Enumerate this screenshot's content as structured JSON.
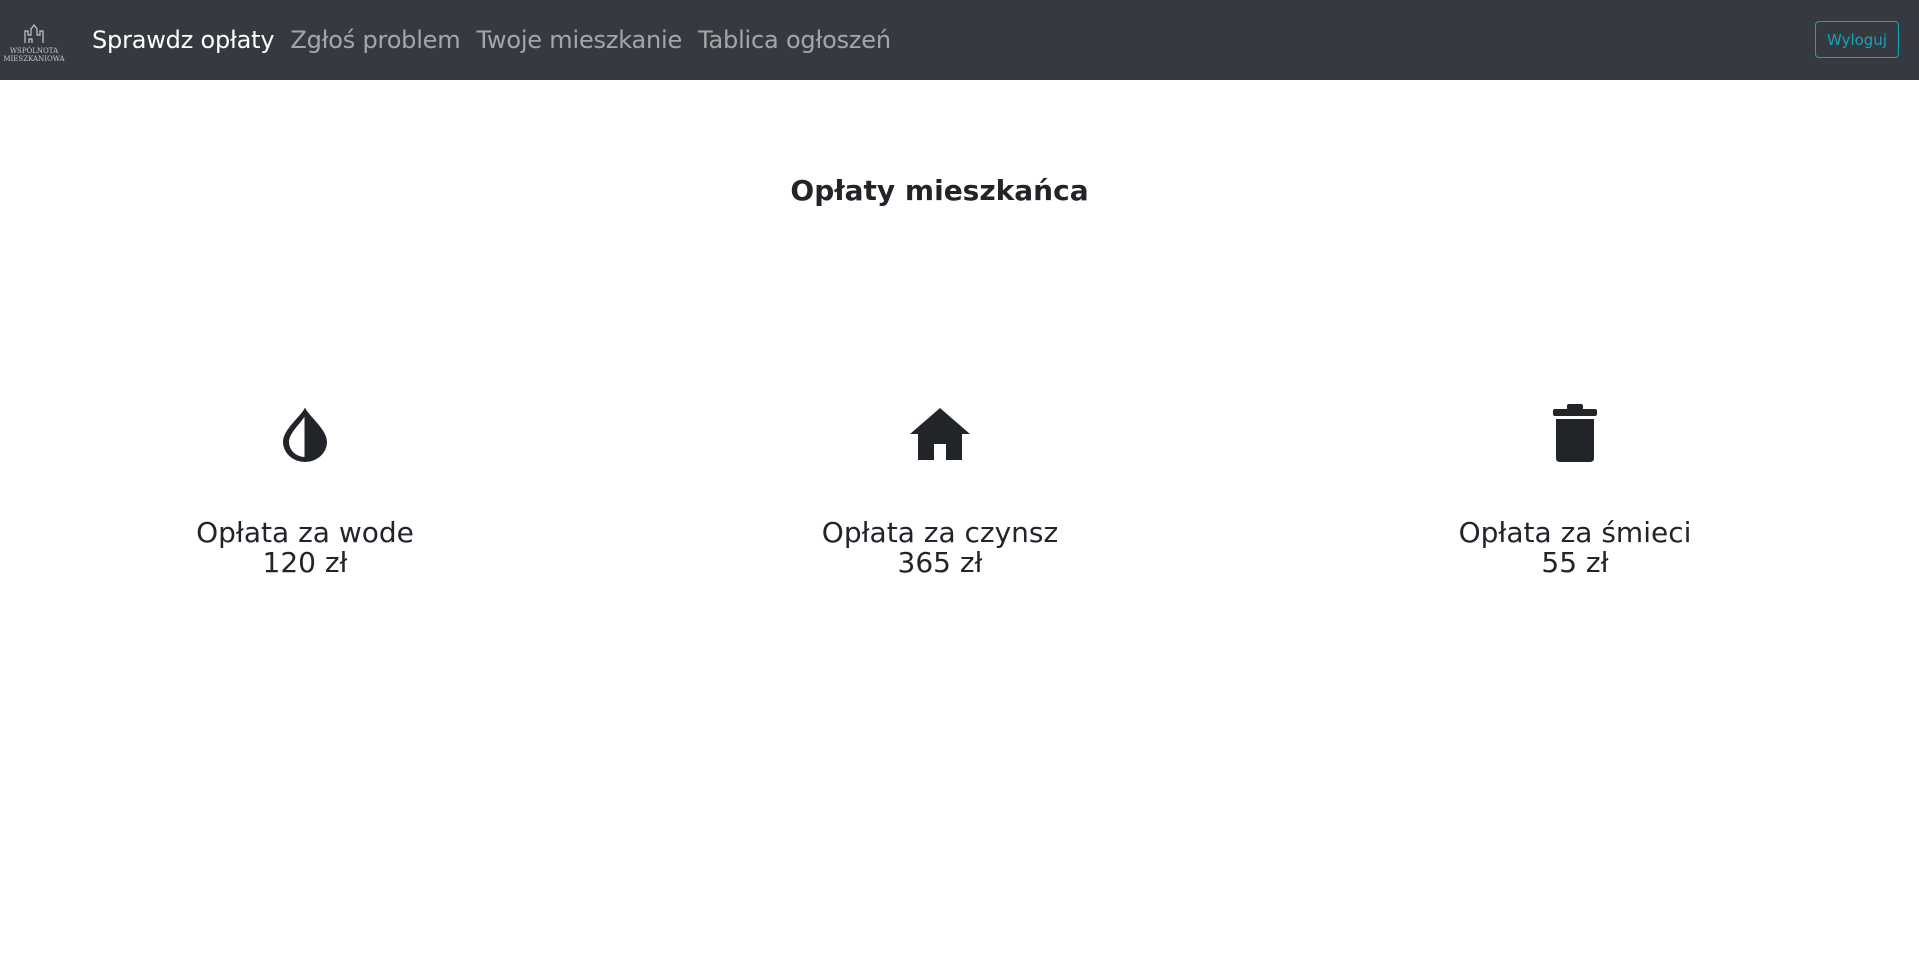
{
  "navbar": {
    "logo_text": [
      "WSPÓLNOTA",
      "MIESZKANIOWA"
    ],
    "links": [
      {
        "label": "Sprawdz opłaty",
        "active": true
      },
      {
        "label": "Zgłoś problem",
        "active": false
      },
      {
        "label": "Twoje mieszkanie",
        "active": false
      },
      {
        "label": "Tablica ogłoszeń",
        "active": false
      }
    ],
    "logout_label": "Wyloguj"
  },
  "main": {
    "title": "Opłaty mieszkańca",
    "fees": [
      {
        "icon": "water-drop-icon",
        "label": "Opłata za wode",
        "amount": "120 zł"
      },
      {
        "icon": "house-icon",
        "label": "Opłata za czynsz",
        "amount": "365 zł"
      },
      {
        "icon": "trash-icon",
        "label": "Opłata za śmieci",
        "amount": "55 zł"
      }
    ]
  },
  "colors": {
    "navbar_bg": "#343a40",
    "accent": "#17a2b8",
    "text": "#212529"
  }
}
